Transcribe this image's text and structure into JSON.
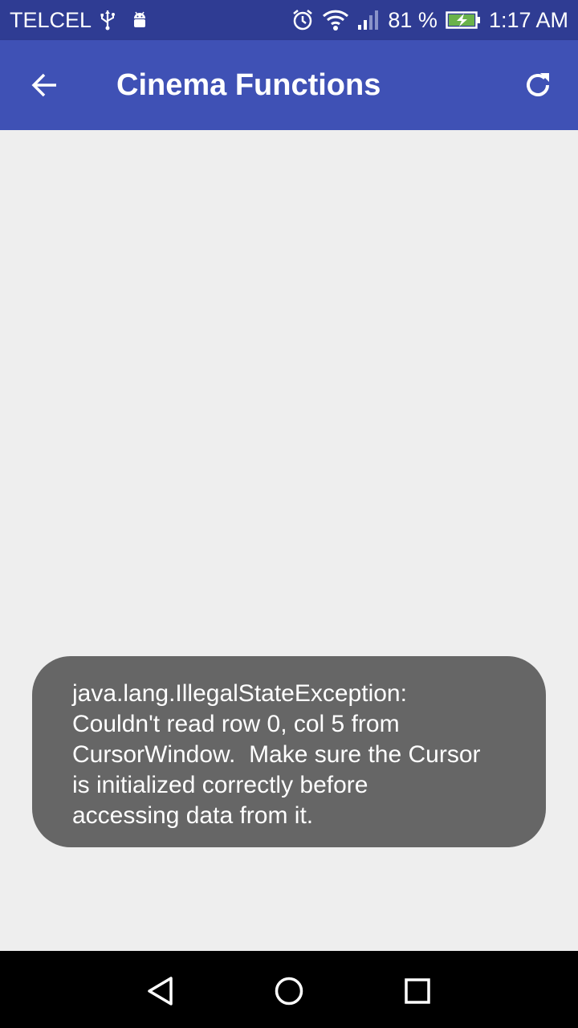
{
  "status_bar": {
    "carrier": "TELCEL",
    "icons_left": [
      "usb-icon",
      "android-debug-icon"
    ],
    "icons_right": [
      "alarm-icon",
      "wifi-icon",
      "signal-icon",
      "battery-charging-icon"
    ],
    "battery_percent": "81 %",
    "time": "1:17 AM"
  },
  "app_bar": {
    "title": "Cinema Functions",
    "back_icon": "arrow-back-icon",
    "refresh_icon": "refresh-icon"
  },
  "toast": {
    "lines": [
      "java.lang.IllegalStateException:",
      "Couldn't read row 0, col 5 from",
      "CursorWindow.  Make sure the Cursor",
      "is initialized correctly before",
      "accessing data from it."
    ]
  },
  "nav_bar": {
    "icons": [
      "nav-back-icon",
      "nav-home-icon",
      "nav-recents-icon"
    ]
  },
  "colors": {
    "status_bar": "#2f3c93",
    "app_bar": "#3f51b5",
    "background": "#eeeeee",
    "toast": "#666666",
    "nav_bar": "#000000"
  }
}
